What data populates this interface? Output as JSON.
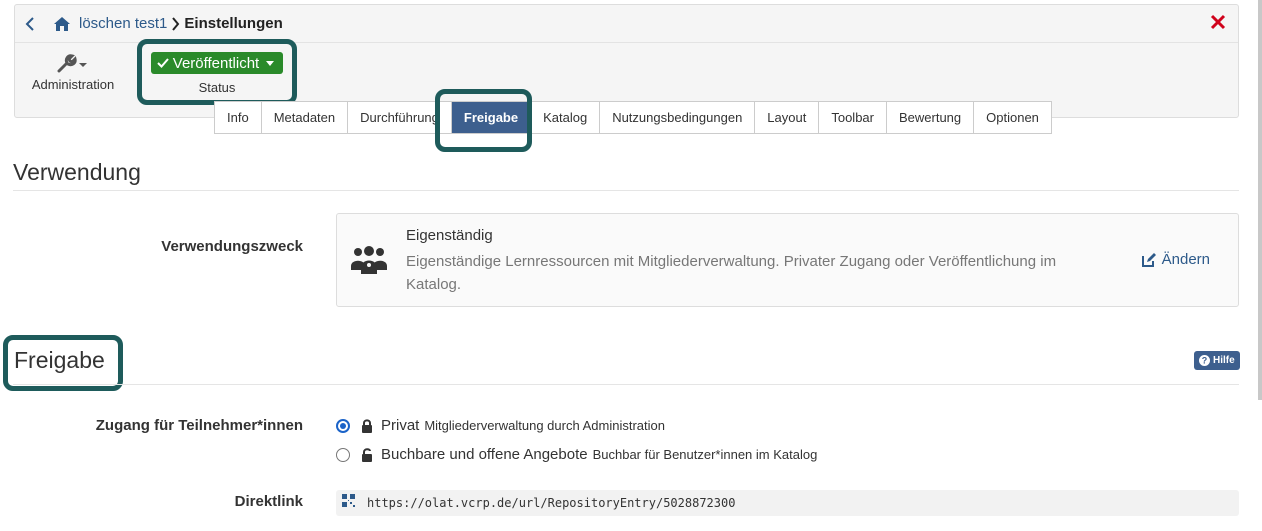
{
  "breadcrumb": {
    "parent": "löschen test1",
    "current": "Einstellungen"
  },
  "toolbar": {
    "admin_label": "Administration",
    "status_value": "Veröffentlicht",
    "status_label": "Status"
  },
  "tabs": [
    {
      "label": "Info"
    },
    {
      "label": "Metadaten"
    },
    {
      "label": "Durchführung"
    },
    {
      "label": "Freigabe",
      "active": true
    },
    {
      "label": "Katalog"
    },
    {
      "label": "Nutzungsbedingungen"
    },
    {
      "label": "Layout"
    },
    {
      "label": "Toolbar"
    },
    {
      "label": "Bewertung"
    },
    {
      "label": "Optionen"
    }
  ],
  "verwendung": {
    "title": "Verwendung",
    "field_label": "Verwendungszweck",
    "card_title": "Eigenständig",
    "card_desc": "Eigenständige Lernressourcen mit Mitgliederverwaltung. Privater Zugang oder Veröffentlichung im Katalog.",
    "change_label": "Ändern"
  },
  "freigabe": {
    "title": "Freigabe",
    "help_label": "Hilfe",
    "access_label": "Zugang für Teilnehmer*innen",
    "options": [
      {
        "main": "Privat",
        "sub": "Mitgliederverwaltung durch Administration",
        "checked": true
      },
      {
        "main": "Buchbare und offene Angebote",
        "sub": "Buchbar für Benutzer*innen im Katalog",
        "checked": false
      }
    ],
    "link_label": "Direktlink",
    "link_value": "https://olat.vcrp.de/url/RepositoryEntry/5028872300"
  },
  "colors": {
    "accent": "#3d5f8e",
    "highlight": "#1e5b5b",
    "status_green": "#2a8a2a",
    "close_red": "#d0021b"
  }
}
